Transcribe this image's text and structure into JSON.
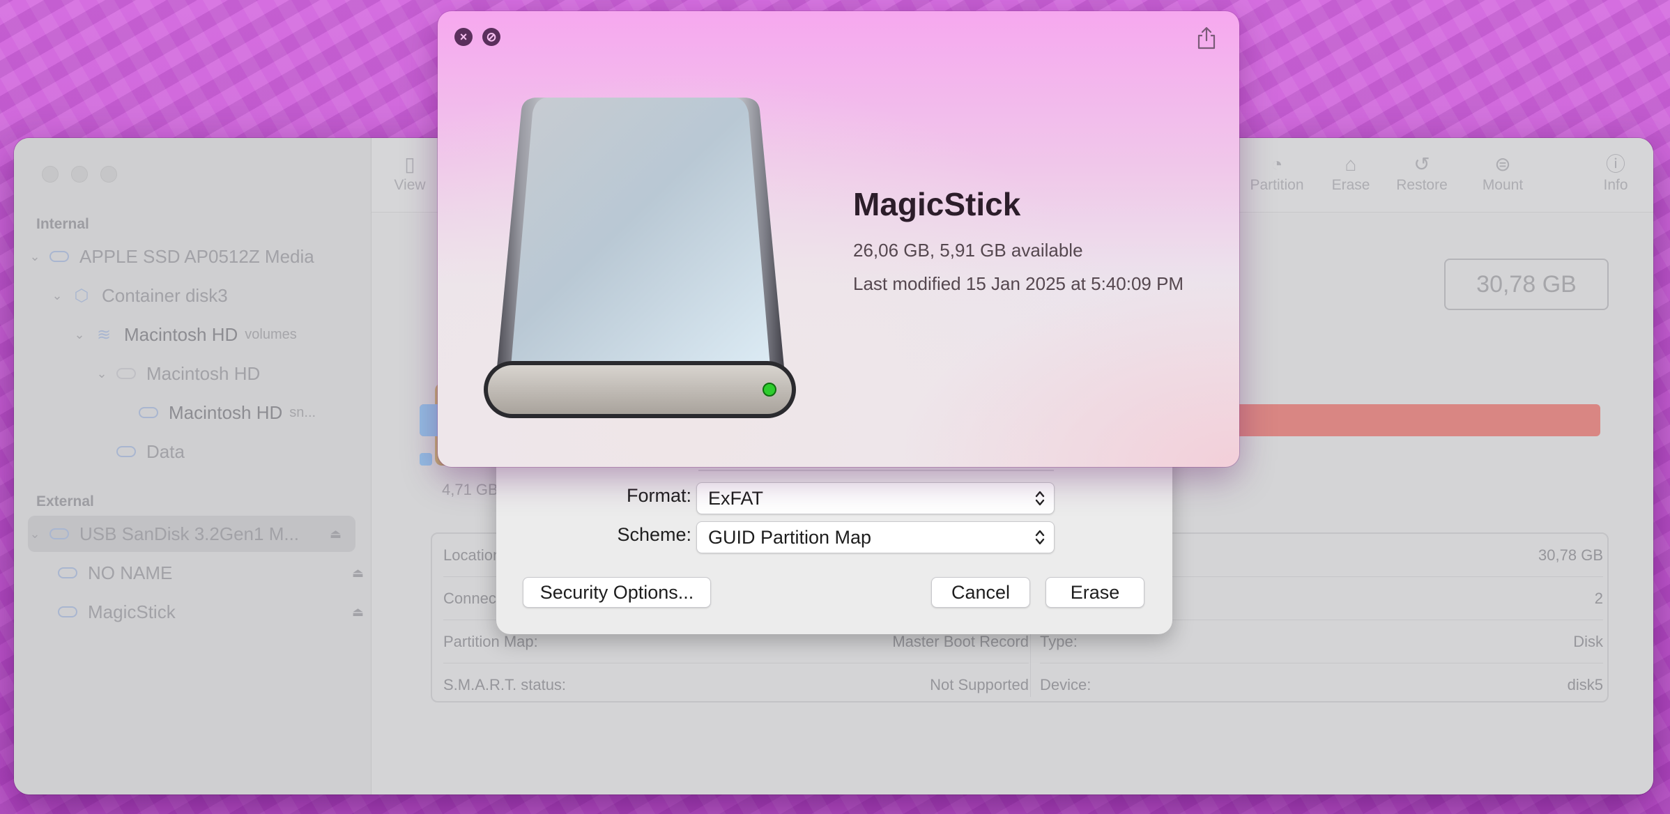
{
  "window": {
    "sidebar": {
      "internal_label": "Internal",
      "external_label": "External",
      "items": [
        {
          "label": "APPLE SSD AP0512Z Media",
          "sub": ""
        },
        {
          "label": "Container disk3",
          "sub": ""
        },
        {
          "label": "Macintosh HD",
          "sub": "volumes"
        },
        {
          "label": "Macintosh HD",
          "sub": ""
        },
        {
          "label": "Macintosh HD",
          "sub": "sn..."
        },
        {
          "label": "Data",
          "sub": ""
        },
        {
          "label": "USB SanDisk 3.2Gen1 M...",
          "sub": ""
        },
        {
          "label": "NO NAME",
          "sub": ""
        },
        {
          "label": "MagicStick",
          "sub": ""
        }
      ]
    },
    "toolbar": {
      "view_label": "View",
      "partition_label": "Partition",
      "erase_label": "Erase",
      "restore_label": "Restore",
      "mount_label": "Mount",
      "info_label": "Info"
    },
    "capacity": "30,78 GB",
    "usage_used_label": "4,71 GB",
    "info": {
      "location_label": "Location:",
      "location_value": "",
      "capacity_value": "30,78 GB",
      "connection_label": "Connecti",
      "child_count_value": "2",
      "partition_map_label": "Partition Map:",
      "partition_map_value": "Master Boot Record",
      "type_label": "Type:",
      "type_value": "Disk",
      "smart_label": "S.M.A.R.T. status:",
      "smart_value": "Not Supported",
      "device_label": "Device:",
      "device_value": "disk5"
    }
  },
  "erase_sheet": {
    "format_label": "Format:",
    "format_value": "ExFAT",
    "scheme_label": "Scheme:",
    "scheme_value": "GUID Partition Map",
    "security_button": "Security Options...",
    "cancel_button": "Cancel",
    "erase_button": "Erase"
  },
  "quick_look": {
    "title": "MagicStick",
    "size_line": "26,06 GB, 5,91 GB available",
    "modified_line": "Last modified 15 Jan 2025 at 5:40:09 PM",
    "close_glyph": "×",
    "fullscreen_glyph": "⊘"
  },
  "colors": {
    "wallpaper": "#c65ad0",
    "usage_free": "#d98683",
    "usage_used": "#94bde3",
    "drive_led": "#2ecc2e"
  }
}
